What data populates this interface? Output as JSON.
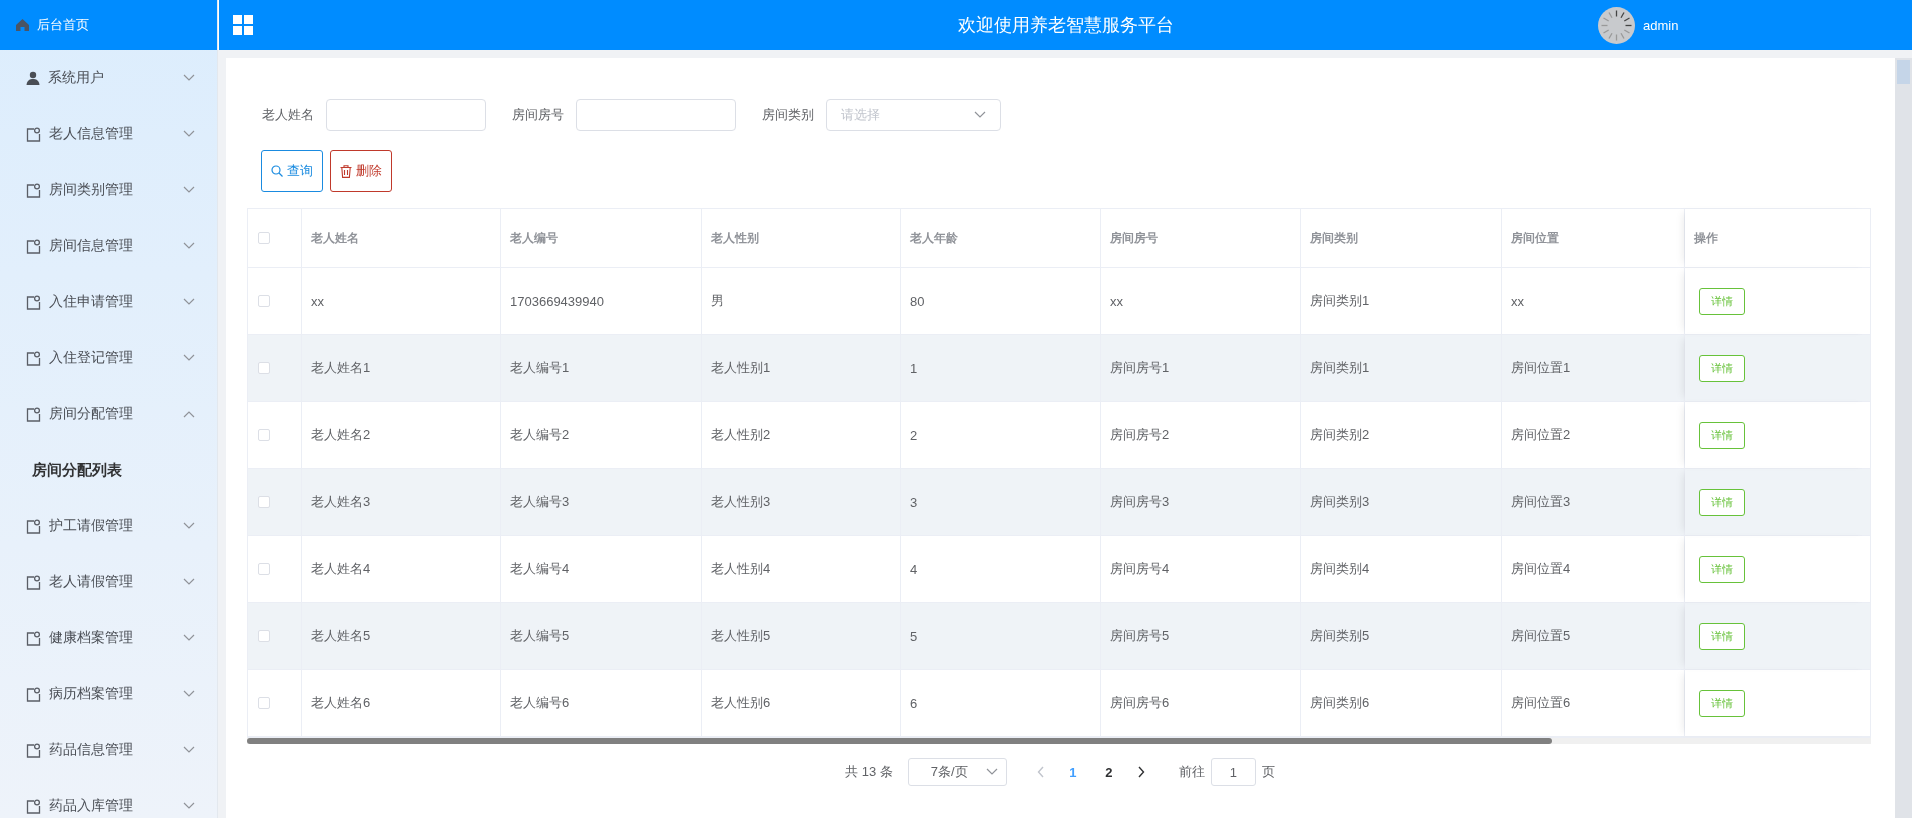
{
  "sidebar": {
    "home": {
      "label": "后台首页"
    },
    "items": [
      {
        "label": "系统用户",
        "kind": "user",
        "expanded": false
      },
      {
        "label": "老人信息管理",
        "kind": "menu",
        "expanded": false
      },
      {
        "label": "房间类别管理",
        "kind": "menu",
        "expanded": false
      },
      {
        "label": "房间信息管理",
        "kind": "menu",
        "expanded": false
      },
      {
        "label": "入住申请管理",
        "kind": "menu",
        "expanded": false
      },
      {
        "label": "入住登记管理",
        "kind": "menu",
        "expanded": false
      },
      {
        "label": "房间分配管理",
        "kind": "menu",
        "expanded": true,
        "children": [
          {
            "label": "房间分配列表"
          }
        ]
      },
      {
        "label": "护工请假管理",
        "kind": "menu",
        "expanded": false
      },
      {
        "label": "老人请假管理",
        "kind": "menu",
        "expanded": false
      },
      {
        "label": "健康档案管理",
        "kind": "menu",
        "expanded": false
      },
      {
        "label": "病历档案管理",
        "kind": "menu",
        "expanded": false
      },
      {
        "label": "药品信息管理",
        "kind": "menu",
        "expanded": false
      },
      {
        "label": "药品入库管理",
        "kind": "menu",
        "expanded": false
      }
    ]
  },
  "header": {
    "title": "欢迎使用养老智慧服务平台",
    "user": "admin"
  },
  "search": {
    "fields": [
      {
        "label": "老人姓名",
        "kind": "input"
      },
      {
        "label": "房间房号",
        "kind": "input"
      },
      {
        "label": "房间类别",
        "kind": "select",
        "placeholder": "请选择"
      }
    ],
    "buttons": [
      {
        "label": "查询",
        "kind": "search"
      },
      {
        "label": "删除",
        "kind": "delete"
      }
    ]
  },
  "table": {
    "all_checked": false,
    "columns": [
      "老人姓名",
      "老人编号",
      "老人性别",
      "老人年龄",
      "房间房号",
      "房间类别",
      "房间位置",
      "操作"
    ],
    "rows": [
      {
        "checked": false,
        "cells": [
          "xx",
          "1703669439940",
          "男",
          "80",
          "xx",
          "房间类别1",
          "xx"
        ],
        "action": "详情"
      },
      {
        "checked": false,
        "cells": [
          "老人姓名1",
          "老人编号1",
          "老人性别1",
          "1",
          "房间房号1",
          "房间类别1",
          "房间位置1"
        ],
        "action": "详情"
      },
      {
        "checked": false,
        "cells": [
          "老人姓名2",
          "老人编号2",
          "老人性别2",
          "2",
          "房间房号2",
          "房间类别2",
          "房间位置2"
        ],
        "action": "详情"
      },
      {
        "checked": false,
        "cells": [
          "老人姓名3",
          "老人编号3",
          "老人性别3",
          "3",
          "房间房号3",
          "房间类别3",
          "房间位置3"
        ],
        "action": "详情"
      },
      {
        "checked": false,
        "cells": [
          "老人姓名4",
          "老人编号4",
          "老人性别4",
          "4",
          "房间房号4",
          "房间类别4",
          "房间位置4"
        ],
        "action": "详情"
      },
      {
        "checked": false,
        "cells": [
          "老人姓名5",
          "老人编号5",
          "老人性别5",
          "5",
          "房间房号5",
          "房间类别5",
          "房间位置5"
        ],
        "action": "详情"
      },
      {
        "checked": false,
        "cells": [
          "老人姓名6",
          "老人编号6",
          "老人性别6",
          "6",
          "房间房号6",
          "房间类别6",
          "房间位置6"
        ],
        "action": "详情"
      }
    ]
  },
  "pagination": {
    "total": "共 13 条",
    "page_size": "7条/页",
    "prev_disabled": true,
    "pages": [
      {
        "label": "1",
        "selected": true
      },
      {
        "label": "2",
        "selected": false
      }
    ],
    "goto_label": "前往",
    "goto_value": "1",
    "goto_suffix": "页"
  }
}
